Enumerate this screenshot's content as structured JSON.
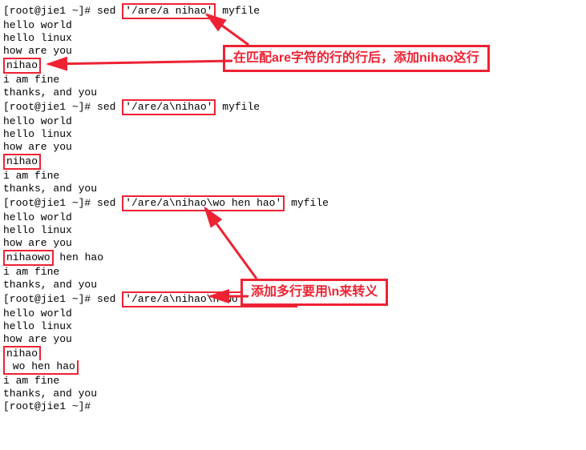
{
  "prompt": "[root@jie1 ~]#",
  "cmd": "sed",
  "file": "myfile",
  "args": {
    "a1": "'/are/a nihao'",
    "a2": "'/are/a\\nihao'",
    "a3": "'/are/a\\nihao\\wo hen hao'",
    "a4": "'/are/a\\nihao\\n wo hen hao'"
  },
  "out": {
    "hw": "hello world",
    "hl": "hello linux",
    "hay": "how are you",
    "nihao": "nihao",
    "iaf": "i am fine",
    "tay": "thanks, and you",
    "nihaowo": "nihaowo",
    "henhao": " hen hao",
    "wohenhao": " wo hen hao"
  },
  "anno": {
    "a1": "在匹配are字符的行的行后，添加nihao这行",
    "a2": "添加多行要用\\n来转义"
  }
}
